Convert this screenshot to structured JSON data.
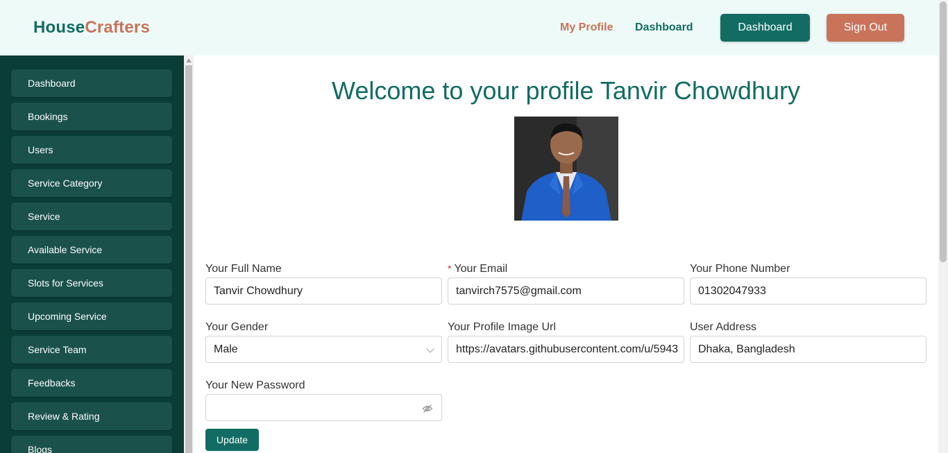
{
  "header": {
    "logo_part1": "House",
    "logo_part2": "Crafters",
    "nav_my_profile": "My Profile",
    "nav_dashboard": "Dashboard",
    "button_dashboard": "Dashboard",
    "button_sign_out": "Sign Out"
  },
  "sidebar": {
    "items": [
      {
        "label": "Dashboard"
      },
      {
        "label": "Bookings"
      },
      {
        "label": "Users"
      },
      {
        "label": "Service Category"
      },
      {
        "label": "Service"
      },
      {
        "label": "Available Service"
      },
      {
        "label": "Slots for Services"
      },
      {
        "label": "Upcoming Service"
      },
      {
        "label": "Service Team"
      },
      {
        "label": "Feedbacks"
      },
      {
        "label": "Review & Rating"
      },
      {
        "label": "Blogs"
      }
    ]
  },
  "profile": {
    "welcome": "Welcome to your profile Tanvir Chowdhury",
    "form": {
      "full_name_label": "Your Full Name",
      "full_name_value": "Tanvir Chowdhury",
      "email_required_mark": "*",
      "email_label": "Your Email",
      "email_value": "tanvirch7575@gmail.com",
      "phone_label": "Your Phone Number",
      "phone_value": "01302047933",
      "gender_label": "Your Gender",
      "gender_value": "Male",
      "image_url_label": "Your Profile Image Url",
      "image_url_value": "https://avatars.githubusercontent.com/u/5943",
      "address_label": "User Address",
      "address_value": "Dhaka, Bangladesh",
      "password_label": "Your New Password",
      "password_value": "",
      "update_button": "Update"
    }
  },
  "colors": {
    "brand_teal": "#126c63",
    "brand_orange": "#c8735a",
    "sidebar_bg": "#0b3d37",
    "sidebar_item_bg": "#1a514b",
    "header_bg": "#eefaf8"
  },
  "icons": {
    "gender_select": "chevron-down-icon",
    "password_toggle": "eye-slash-icon"
  }
}
